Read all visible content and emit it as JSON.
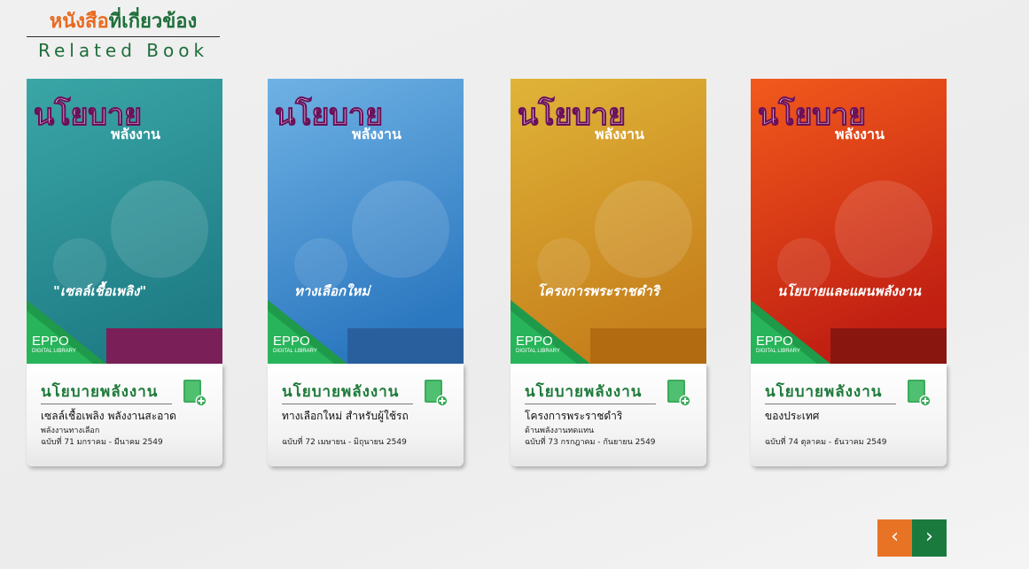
{
  "header": {
    "title_th_orange": "หนังสือ",
    "title_th_green": "ที่เกี่ยวข้อง",
    "title_en": "Related Book"
  },
  "books": [
    {
      "title": "นโยบายพลังงาน",
      "line1": "เซลล์เชื้อเพลิง  พลังงานสะอาด",
      "line2": "พลังงานทางเลือก",
      "line3": "ฉบับที่ 71 มกราคม - มีนาคม 2549",
      "cover": {
        "bg1": "#3aa6a6",
        "bg2": "#1f7d86",
        "headline": "นโยบาย",
        "sub": "พลังงาน",
        "caption": "\"เซลล์เชื้อเพลิง\"",
        "bottom": "#7b1f58"
      }
    },
    {
      "title": "นโยบายพลังงาน",
      "line1": "ทางเลือกใหม่  สำหรับผู้ใช้รถ",
      "line2": "",
      "line3": "ฉบับที่ 72 เมษายน - มิถุนายน 2549",
      "cover": {
        "bg1": "#6fb2e4",
        "bg2": "#2c78c0",
        "headline": "นโยบาย",
        "sub": "พลังงาน",
        "caption": "ทางเลือกใหม่",
        "bottom": "#2a5f9e"
      }
    },
    {
      "title": "นโยบายพลังงาน",
      "line1": "โครงการพระราชดำริ",
      "line2": "ด้านพลังงานทดแทน",
      "line3": "ฉบับที่ 73 กรกฎาคม - กันยายน 2549",
      "cover": {
        "bg1": "#e0b438",
        "bg2": "#c6801c",
        "headline": "นโยบาย",
        "sub": "พลังงาน",
        "caption": "โครงการพระราชดำริ",
        "bottom": "#b36b12"
      }
    },
    {
      "title": "นโยบายพลังงาน",
      "line1": "ของประเทศ",
      "line2": "",
      "line3": "ฉบับที่ 74 ตุลาคม - ธันวาคม 2549",
      "cover": {
        "bg1": "#f25a1c",
        "bg2": "#c01f12",
        "headline": "นโยบาย",
        "sub": "พลังงาน",
        "caption": "นโยบายและแผนพลังงาน",
        "bottom": "#8a1610"
      }
    }
  ],
  "library_badge": {
    "brand": "EPPO",
    "sub": "DIGITAL LIBRARY"
  },
  "nav": {
    "prev": "‹",
    "next": "›"
  },
  "colors": {
    "orange": "#e87325",
    "green": "#1a7a3e"
  }
}
